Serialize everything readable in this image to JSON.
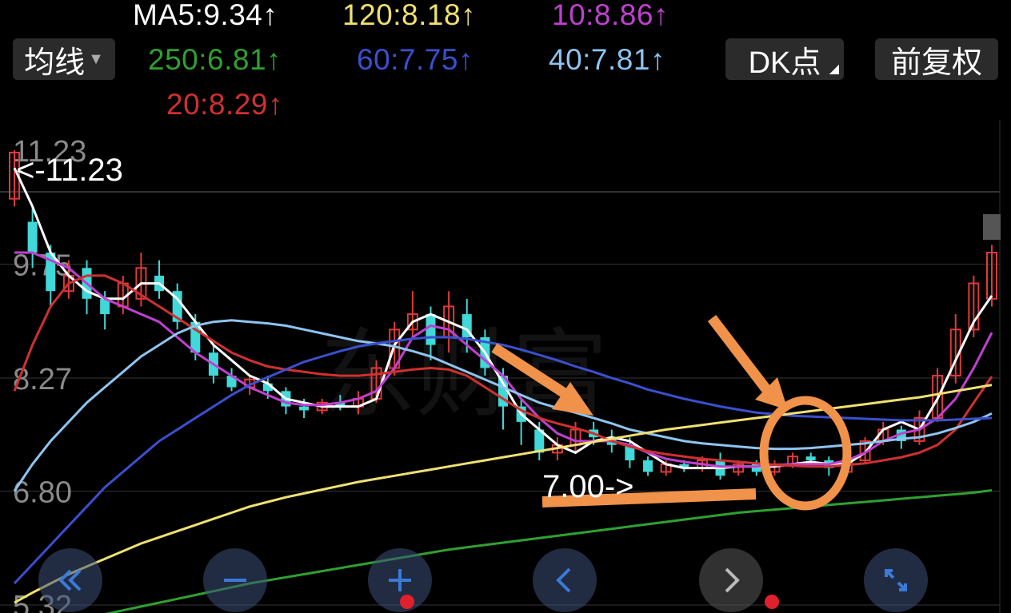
{
  "toolbar": {
    "ma_button": "均线",
    "dk_button": "DK点",
    "adjust_button": "前复权"
  },
  "legend": {
    "ma5": "MA5:9.34↑",
    "ma120": "120:8.18↑",
    "ma10": "10:8.86↑",
    "ma250": "250:6.81↑",
    "ma60": "60:7.75↑",
    "ma40": "40:7.81↑",
    "ma20": "20:8.29↑"
  },
  "colors": {
    "ma5": "#ffffff",
    "ma10": "#c040d0",
    "ma20": "#d03030",
    "ma40": "#8ec4f0",
    "ma60": "#3a50d0",
    "ma120": "#f0e070",
    "ma250": "#30a030",
    "up": "#e03a3a",
    "down": "#40d8d8",
    "annotation": "#f0924a"
  },
  "nav_icons": [
    "double-left-icon",
    "zoom-out-icon",
    "zoom-in-icon",
    "prev-icon",
    "next-icon",
    "expand-icon"
  ],
  "chart_data": {
    "type": "candlestick",
    "y_ticks": [
      "11.23",
      "9.75",
      "8.27",
      "6.80",
      "5.32"
    ],
    "y_tick_values": [
      11.23,
      9.75,
      8.27,
      6.8,
      5.32
    ],
    "high_label": "<-11.23",
    "low_label": "7.00->",
    "ylim": [
      5.32,
      11.23
    ],
    "series": [
      {
        "name": "MA5",
        "values": [
          11.0,
          10.5,
          9.9,
          9.6,
          9.4,
          9.3,
          9.3,
          9.5,
          9.5,
          9.3,
          9.0,
          8.7,
          8.5,
          8.3,
          8.2,
          8.0,
          7.95,
          7.9,
          7.9,
          7.9,
          8.0,
          8.7,
          9.0,
          9.1,
          9.0,
          8.9,
          8.6,
          8.2,
          7.8,
          7.6,
          7.4,
          7.3,
          7.45,
          7.5,
          7.45,
          7.3,
          7.15,
          7.1,
          7.1,
          7.1,
          7.12,
          7.12,
          7.12,
          7.15,
          7.18,
          7.15,
          7.15,
          7.3,
          7.6,
          7.7,
          7.6,
          8.0,
          8.5,
          9.0,
          9.34
        ]
      },
      {
        "name": "10",
        "values": [
          9.9,
          9.9,
          9.8,
          9.7,
          9.5,
          9.3,
          9.2,
          9.1,
          9.0,
          8.8,
          8.6,
          8.45,
          8.3,
          8.15,
          8.05,
          7.95,
          7.92,
          7.92,
          7.95,
          8.0,
          8.1,
          8.4,
          8.8,
          8.95,
          8.9,
          8.7,
          8.5,
          8.3,
          8.0,
          7.75,
          7.55,
          7.45,
          7.45,
          7.45,
          7.4,
          7.3,
          7.22,
          7.18,
          7.15,
          7.12,
          7.12,
          7.12,
          7.14,
          7.15,
          7.15,
          7.15,
          7.2,
          7.3,
          7.45,
          7.55,
          7.6,
          7.75,
          8.0,
          8.4,
          8.86
        ]
      },
      {
        "name": "20",
        "values": [
          8.1,
          8.7,
          9.2,
          9.5,
          9.6,
          9.6,
          9.5,
          9.35,
          9.2,
          9.05,
          8.9,
          8.75,
          8.6,
          8.5,
          8.42,
          8.38,
          8.35,
          8.32,
          8.3,
          8.3,
          8.32,
          8.35,
          8.38,
          8.4,
          8.38,
          8.3,
          8.15,
          8.0,
          7.85,
          7.75,
          7.68,
          7.62,
          7.55,
          7.45,
          7.38,
          7.32,
          7.28,
          7.25,
          7.22,
          7.2,
          7.18,
          7.16,
          7.14,
          7.13,
          7.12,
          7.12,
          7.14,
          7.16,
          7.2,
          7.24,
          7.3,
          7.4,
          7.6,
          7.95,
          8.29
        ]
      },
      {
        "name": "40",
        "values": [
          6.8,
          7.15,
          7.45,
          7.7,
          7.95,
          8.15,
          8.35,
          8.55,
          8.7,
          8.85,
          8.95,
          9.0,
          9.02,
          9.0,
          8.98,
          8.95,
          8.9,
          8.85,
          8.8,
          8.75,
          8.72,
          8.68,
          8.62,
          8.55,
          8.45,
          8.35,
          8.25,
          8.15,
          8.05,
          7.95,
          7.88,
          7.82,
          7.75,
          7.68,
          7.6,
          7.55,
          7.5,
          7.45,
          7.42,
          7.4,
          7.38,
          7.36,
          7.35,
          7.35,
          7.36,
          7.38,
          7.4,
          7.42,
          7.45,
          7.48,
          7.5,
          7.55,
          7.62,
          7.7,
          7.81
        ]
      },
      {
        "name": "60",
        "values": [
          5.6,
          5.85,
          6.1,
          6.35,
          6.6,
          6.85,
          7.05,
          7.25,
          7.45,
          7.6,
          7.75,
          7.9,
          8.05,
          8.18,
          8.28,
          8.38,
          8.48,
          8.55,
          8.62,
          8.68,
          8.72,
          8.75,
          8.78,
          8.8,
          8.8,
          8.78,
          8.74,
          8.7,
          8.64,
          8.57,
          8.5,
          8.42,
          8.35,
          8.27,
          8.2,
          8.12,
          8.06,
          8.0,
          7.95,
          7.9,
          7.86,
          7.82,
          7.8,
          7.78,
          7.77,
          7.76,
          7.75,
          7.74,
          7.73,
          7.72,
          7.72,
          7.72,
          7.73,
          7.74,
          7.75
        ]
      },
      {
        "name": "120",
        "values": [
          5.35,
          5.48,
          5.6,
          5.72,
          5.82,
          5.92,
          6.02,
          6.12,
          6.2,
          6.28,
          6.36,
          6.44,
          6.52,
          6.6,
          6.66,
          6.72,
          6.77,
          6.82,
          6.87,
          6.92,
          6.96,
          7.0,
          7.04,
          7.08,
          7.12,
          7.16,
          7.2,
          7.24,
          7.28,
          7.32,
          7.36,
          7.4,
          7.44,
          7.48,
          7.52,
          7.56,
          7.6,
          7.63,
          7.66,
          7.69,
          7.72,
          7.75,
          7.78,
          7.81,
          7.84,
          7.87,
          7.9,
          7.93,
          7.96,
          7.99,
          8.02,
          8.06,
          8.1,
          8.14,
          8.18
        ]
      },
      {
        "name": "250",
        "values": [
          4.95,
          5.0,
          5.05,
          5.1,
          5.15,
          5.2,
          5.25,
          5.3,
          5.35,
          5.4,
          5.45,
          5.5,
          5.55,
          5.6,
          5.64,
          5.68,
          5.72,
          5.76,
          5.8,
          5.84,
          5.88,
          5.92,
          5.96,
          6.0,
          6.04,
          6.07,
          6.1,
          6.13,
          6.16,
          6.19,
          6.22,
          6.25,
          6.28,
          6.31,
          6.34,
          6.37,
          6.4,
          6.43,
          6.46,
          6.49,
          6.52,
          6.54,
          6.56,
          6.58,
          6.6,
          6.62,
          6.64,
          6.66,
          6.68,
          6.7,
          6.72,
          6.74,
          6.76,
          6.78,
          6.81
        ]
      }
    ],
    "candles": [
      {
        "o": 10.6,
        "c": 11.2,
        "h": 11.23,
        "l": 10.5
      },
      {
        "o": 10.3,
        "c": 9.9,
        "h": 10.5,
        "l": 9.7
      },
      {
        "o": 9.9,
        "c": 9.4,
        "h": 10.0,
        "l": 9.2
      },
      {
        "o": 9.4,
        "c": 9.6,
        "h": 9.8,
        "l": 9.3
      },
      {
        "o": 9.7,
        "c": 9.3,
        "h": 9.8,
        "l": 9.1
      },
      {
        "o": 9.3,
        "c": 9.1,
        "h": 9.4,
        "l": 8.9
      },
      {
        "o": 9.2,
        "c": 9.5,
        "h": 9.6,
        "l": 9.1
      },
      {
        "o": 9.3,
        "c": 9.7,
        "h": 9.9,
        "l": 9.2
      },
      {
        "o": 9.6,
        "c": 9.4,
        "h": 9.8,
        "l": 9.3
      },
      {
        "o": 9.4,
        "c": 9.0,
        "h": 9.5,
        "l": 8.9
      },
      {
        "o": 9.0,
        "c": 8.6,
        "h": 9.1,
        "l": 8.5
      },
      {
        "o": 8.6,
        "c": 8.3,
        "h": 8.7,
        "l": 8.2
      },
      {
        "o": 8.3,
        "c": 8.15,
        "h": 8.4,
        "l": 8.1
      },
      {
        "o": 8.15,
        "c": 8.25,
        "h": 8.3,
        "l": 8.05
      },
      {
        "o": 8.2,
        "c": 8.1,
        "h": 8.3,
        "l": 8.0
      },
      {
        "o": 8.1,
        "c": 7.9,
        "h": 8.15,
        "l": 7.8
      },
      {
        "o": 7.9,
        "c": 7.85,
        "h": 8.0,
        "l": 7.75
      },
      {
        "o": 7.85,
        "c": 7.95,
        "h": 8.0,
        "l": 7.8
      },
      {
        "o": 7.95,
        "c": 7.9,
        "h": 8.05,
        "l": 7.85
      },
      {
        "o": 7.9,
        "c": 8.0,
        "h": 8.1,
        "l": 7.8
      },
      {
        "o": 8.0,
        "c": 8.4,
        "h": 8.5,
        "l": 7.95
      },
      {
        "o": 8.4,
        "c": 8.9,
        "h": 9.0,
        "l": 8.3
      },
      {
        "o": 8.9,
        "c": 9.1,
        "h": 9.4,
        "l": 8.8
      },
      {
        "o": 9.1,
        "c": 8.7,
        "h": 9.2,
        "l": 8.5
      },
      {
        "o": 8.8,
        "c": 9.2,
        "h": 9.4,
        "l": 8.6
      },
      {
        "o": 9.1,
        "c": 8.8,
        "h": 9.3,
        "l": 8.6
      },
      {
        "o": 8.8,
        "c": 8.4,
        "h": 8.9,
        "l": 8.3
      },
      {
        "o": 8.3,
        "c": 7.9,
        "h": 8.4,
        "l": 7.6
      },
      {
        "o": 7.9,
        "c": 7.7,
        "h": 8.0,
        "l": 7.4
      },
      {
        "o": 7.6,
        "c": 7.3,
        "h": 7.7,
        "l": 7.2
      },
      {
        "o": 7.3,
        "c": 7.4,
        "h": 7.5,
        "l": 7.2
      },
      {
        "o": 7.4,
        "c": 7.6,
        "h": 7.7,
        "l": 7.3
      },
      {
        "o": 7.6,
        "c": 7.5,
        "h": 7.7,
        "l": 7.4
      },
      {
        "o": 7.5,
        "c": 7.4,
        "h": 7.6,
        "l": 7.3
      },
      {
        "o": 7.4,
        "c": 7.2,
        "h": 7.5,
        "l": 7.1
      },
      {
        "o": 7.2,
        "c": 7.05,
        "h": 7.25,
        "l": 7.0
      },
      {
        "o": 7.05,
        "c": 7.15,
        "h": 7.2,
        "l": 7.0
      },
      {
        "o": 7.15,
        "c": 7.1,
        "h": 7.2,
        "l": 7.05
      },
      {
        "o": 7.1,
        "c": 7.2,
        "h": 7.25,
        "l": 7.05
      },
      {
        "o": 7.2,
        "c": 7.0,
        "h": 7.3,
        "l": 6.95
      },
      {
        "o": 7.05,
        "c": 7.15,
        "h": 7.2,
        "l": 7.0
      },
      {
        "o": 7.15,
        "c": 7.05,
        "h": 7.2,
        "l": 7.0
      },
      {
        "o": 7.05,
        "c": 7.15,
        "h": 7.2,
        "l": 7.0
      },
      {
        "o": 7.15,
        "c": 7.25,
        "h": 7.3,
        "l": 7.1
      },
      {
        "o": 7.25,
        "c": 7.2,
        "h": 7.3,
        "l": 7.15
      },
      {
        "o": 7.2,
        "c": 7.1,
        "h": 7.25,
        "l": 7.0
      },
      {
        "o": 7.05,
        "c": 7.2,
        "h": 7.3,
        "l": 7.0
      },
      {
        "o": 7.2,
        "c": 7.45,
        "h": 7.5,
        "l": 7.15
      },
      {
        "o": 7.45,
        "c": 7.6,
        "h": 7.7,
        "l": 7.4
      },
      {
        "o": 7.6,
        "c": 7.45,
        "h": 7.65,
        "l": 7.35
      },
      {
        "o": 7.45,
        "c": 7.75,
        "h": 7.85,
        "l": 7.4
      },
      {
        "o": 7.75,
        "c": 8.3,
        "h": 8.4,
        "l": 7.7
      },
      {
        "o": 8.3,
        "c": 8.9,
        "h": 9.1,
        "l": 8.2
      },
      {
        "o": 8.9,
        "c": 9.5,
        "h": 9.6,
        "l": 8.8
      },
      {
        "o": 9.3,
        "c": 9.9,
        "h": 10.0,
        "l": 9.2
      }
    ]
  }
}
